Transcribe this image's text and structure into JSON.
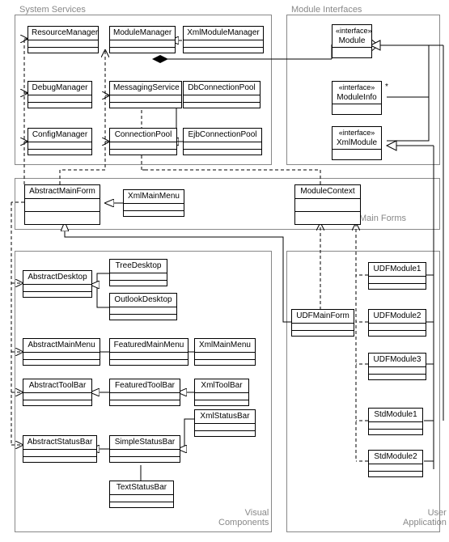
{
  "packages": {
    "systemServices": {
      "label": "System Services"
    },
    "moduleInterfaces": {
      "label": "Module Interfaces"
    },
    "mainForms": {
      "label": "Main Forms"
    },
    "visualComponents": {
      "label": "Visual\nComponents"
    },
    "userApplication": {
      "label": "User\nApplication"
    }
  },
  "classes": {
    "resourceManager": {
      "name": "ResourceManager"
    },
    "moduleManager": {
      "name": "ModuleManager"
    },
    "xmlModuleManager": {
      "name": "XmlModuleManager"
    },
    "debugManager": {
      "name": "DebugManager"
    },
    "messagingService": {
      "name": "MessagingService"
    },
    "dbConnectionPool": {
      "name": "DbConnectionPool"
    },
    "configManager": {
      "name": "ConfigManager"
    },
    "connectionPool": {
      "name": "ConnectionPool"
    },
    "ejbConnectionPool": {
      "name": "EjbConnectionPool"
    },
    "module": {
      "stereo": "«interface»",
      "name": "Module"
    },
    "moduleInfo": {
      "stereo": "«interface»",
      "name": "ModuleInfo"
    },
    "xmlModule": {
      "stereo": "«interface»",
      "name": "XmlModule"
    },
    "abstractMainForm": {
      "name": "AbstractMainForm"
    },
    "xmlMainMenuMF": {
      "name": "XmlMainMenu"
    },
    "moduleContext": {
      "name": "ModuleContext"
    },
    "abstractDesktop": {
      "name": "AbstractDesktop"
    },
    "treeDesktop": {
      "name": "TreeDesktop"
    },
    "outlookDesktop": {
      "name": "OutlookDesktop"
    },
    "abstractMainMenu": {
      "name": "AbstractMainMenu"
    },
    "featuredMainMenu": {
      "name": "FeaturedMainMenu"
    },
    "xmlMainMenuVC": {
      "name": "XmlMainMenu"
    },
    "abstractToolBar": {
      "name": "AbstractToolBar"
    },
    "featuredToolBar": {
      "name": "FeaturedToolBar"
    },
    "xmlToolBar": {
      "name": "XmlToolBar"
    },
    "abstractStatusBar": {
      "name": "AbstractStatusBar"
    },
    "simpleStatusBar": {
      "name": "SimpleStatusBar"
    },
    "xmlStatusBar": {
      "name": "XmlStatusBar"
    },
    "textStatusBar": {
      "name": "TextStatusBar"
    },
    "udfMainForm": {
      "name": "UDFMainForm"
    },
    "udfModule1": {
      "name": "UDFModule1"
    },
    "udfModule2": {
      "name": "UDFModule2"
    },
    "udfModule3": {
      "name": "UDFModule3"
    },
    "stdModule1": {
      "name": "StdModule1"
    },
    "stdModule2": {
      "name": "StdModule2"
    }
  },
  "chart_data": {
    "type": "table",
    "description": "UML class diagram",
    "packages": [
      {
        "name": "System Services",
        "classes": [
          "ResourceManager",
          "ModuleManager",
          "XmlModuleManager",
          "DebugManager",
          "MessagingService",
          "DbConnectionPool",
          "ConfigManager",
          "ConnectionPool",
          "EjbConnectionPool"
        ]
      },
      {
        "name": "Module Interfaces",
        "classes": [
          "Module",
          "ModuleInfo",
          "XmlModule"
        ],
        "stereotypes": {
          "Module": "interface",
          "ModuleInfo": "interface",
          "XmlModule": "interface"
        }
      },
      {
        "name": "Main Forms",
        "classes": [
          "AbstractMainForm",
          "XmlMainMenu",
          "ModuleContext"
        ]
      },
      {
        "name": "Visual Components",
        "classes": [
          "AbstractDesktop",
          "TreeDesktop",
          "OutlookDesktop",
          "AbstractMainMenu",
          "FeaturedMainMenu",
          "XmlMainMenu",
          "AbstractToolBar",
          "FeaturedToolBar",
          "XmlToolBar",
          "AbstractStatusBar",
          "SimpleStatusBar",
          "XmlStatusBar",
          "TextStatusBar"
        ]
      },
      {
        "name": "User Application",
        "classes": [
          "UDFMainForm",
          "UDFModule1",
          "UDFModule2",
          "UDFModule3",
          "StdModule1",
          "StdModule2"
        ]
      }
    ],
    "relationships": [
      {
        "from": "XmlModuleManager",
        "to": "ModuleManager",
        "type": "generalization"
      },
      {
        "from": "DbConnectionPool",
        "to": "ConnectionPool",
        "type": "generalization"
      },
      {
        "from": "EjbConnectionPool",
        "to": "ConnectionPool",
        "type": "generalization"
      },
      {
        "from": "ModuleManager",
        "to": "Module",
        "type": "composition"
      },
      {
        "from": "Module",
        "to": "ModuleInfo",
        "type": "association",
        "multiplicity": "*"
      },
      {
        "from": "XmlModule",
        "to": "Module",
        "type": "generalization"
      },
      {
        "from": "XmlMainMenu",
        "to": "AbstractMainForm",
        "type": "generalization",
        "scope": "Main Forms"
      },
      {
        "from": "AbstractMainForm",
        "to": "ModuleManager",
        "type": "dependency"
      },
      {
        "from": "AbstractMainForm",
        "to": "ResourceManager",
        "type": "dependency"
      },
      {
        "from": "AbstractMainForm",
        "to": "DebugManager",
        "type": "dependency"
      },
      {
        "from": "AbstractMainForm",
        "to": "ConfigManager",
        "type": "dependency"
      },
      {
        "from": "AbstractMainForm",
        "to": "MessagingService",
        "type": "dependency"
      },
      {
        "from": "AbstractMainForm",
        "to": "ConnectionPool",
        "type": "dependency"
      },
      {
        "from": "ModuleContext",
        "to": "ModuleManager",
        "type": "dependency"
      },
      {
        "from": "ModuleContext",
        "to": "MessagingService",
        "type": "dependency"
      },
      {
        "from": "TreeDesktop",
        "to": "AbstractDesktop",
        "type": "generalization"
      },
      {
        "from": "OutlookDesktop",
        "to": "AbstractDesktop",
        "type": "generalization"
      },
      {
        "from": "FeaturedMainMenu",
        "to": "AbstractMainMenu",
        "type": "generalization"
      },
      {
        "from": "XmlMainMenu",
        "to": "FeaturedMainMenu",
        "type": "generalization",
        "scope": "Visual Components"
      },
      {
        "from": "FeaturedToolBar",
        "to": "AbstractToolBar",
        "type": "generalization"
      },
      {
        "from": "XmlToolBar",
        "to": "FeaturedToolBar",
        "type": "generalization"
      },
      {
        "from": "SimpleStatusBar",
        "to": "AbstractStatusBar",
        "type": "generalization"
      },
      {
        "from": "XmlStatusBar",
        "to": "SimpleStatusBar",
        "type": "generalization"
      },
      {
        "from": "TextStatusBar",
        "to": "SimpleStatusBar",
        "type": "generalization"
      },
      {
        "from": "AbstractMainForm",
        "to": "AbstractDesktop",
        "type": "dependency"
      },
      {
        "from": "AbstractMainForm",
        "to": "AbstractMainMenu",
        "type": "dependency"
      },
      {
        "from": "AbstractMainForm",
        "to": "AbstractToolBar",
        "type": "dependency"
      },
      {
        "from": "AbstractMainForm",
        "to": "AbstractStatusBar",
        "type": "dependency"
      },
      {
        "from": "UDFMainForm",
        "to": "AbstractMainForm",
        "type": "generalization"
      },
      {
        "from": "UDFMainForm",
        "to": "ModuleContext",
        "type": "dependency"
      },
      {
        "from": "UDFModule1",
        "to": "ModuleContext",
        "type": "dependency"
      },
      {
        "from": "UDFModule2",
        "to": "ModuleContext",
        "type": "dependency"
      },
      {
        "from": "UDFModule3",
        "to": "ModuleContext",
        "type": "dependency"
      },
      {
        "from": "StdModule1",
        "to": "ModuleContext",
        "type": "dependency"
      },
      {
        "from": "StdModule2",
        "to": "ModuleContext",
        "type": "dependency"
      },
      {
        "from": "UDFModule1",
        "to": "XmlModule",
        "type": "generalization"
      },
      {
        "from": "UDFModule2",
        "to": "XmlModule",
        "type": "generalization"
      },
      {
        "from": "UDFModule3",
        "to": "XmlModule",
        "type": "generalization"
      },
      {
        "from": "StdModule1",
        "to": "Module",
        "type": "generalization"
      },
      {
        "from": "StdModule2",
        "to": "Module",
        "type": "generalization"
      }
    ]
  }
}
